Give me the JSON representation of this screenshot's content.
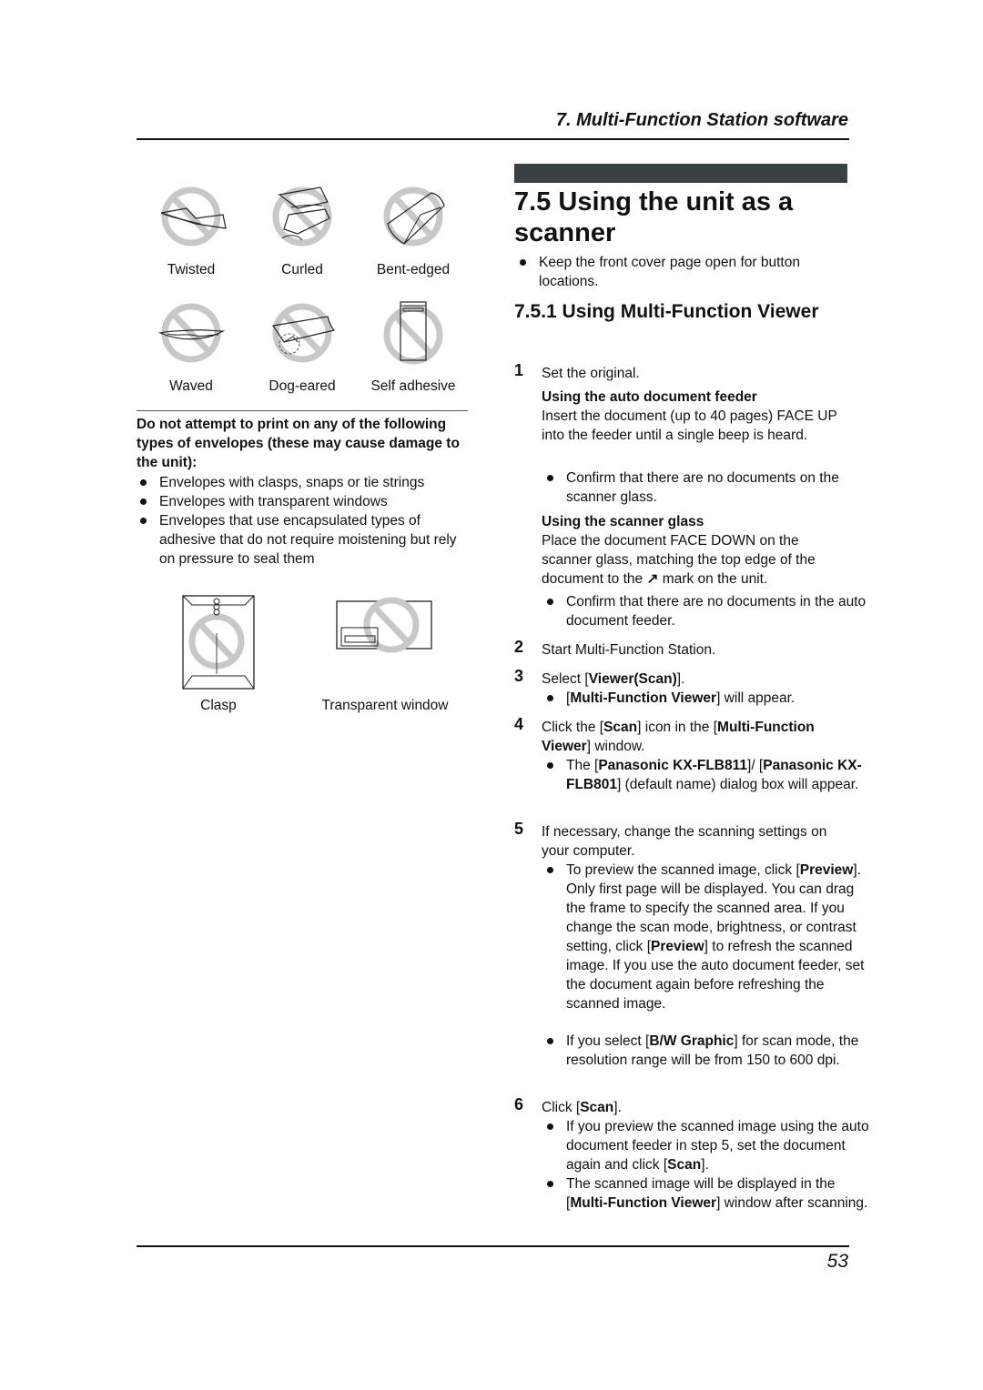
{
  "header": {
    "chapter_title": "7. Multi-Function Station software"
  },
  "footer": {
    "page_number": "53"
  },
  "left": {
    "paper_icons": [
      {
        "label": "Twisted",
        "icon": "twisted-paper-prohibited-icon"
      },
      {
        "label": "Curled",
        "icon": "curled-paper-prohibited-icon"
      },
      {
        "label": "Bent-edged",
        "icon": "bent-edged-paper-prohibited-icon"
      },
      {
        "label": "Waved",
        "icon": "waved-paper-prohibited-icon"
      },
      {
        "label": "Dog-eared",
        "icon": "dog-eared-paper-prohibited-icon"
      },
      {
        "label": "Self adhesive",
        "icon": "self-adhesive-envelope-prohibited-icon"
      }
    ],
    "warning_heading": "Do not attempt to print on any of the following types of envelopes (these may cause damage to the unit):",
    "warning_bullets": [
      "Envelopes with clasps, snaps or tie strings",
      "Envelopes with transparent windows",
      "Envelopes that use encapsulated types of adhesive that do not require moistening but rely on pressure to seal them"
    ],
    "envelope_icons": [
      {
        "label": "Clasp",
        "icon": "clasp-envelope-prohibited-icon"
      },
      {
        "label": "Transparent window",
        "icon": "window-envelope-prohibited-icon"
      }
    ]
  },
  "right": {
    "section_title": "7.5 Using the unit as a scanner",
    "section_note": "Keep the front cover page open for button locations.",
    "subsection_title": "7.5.1 Using Multi-Function Viewer",
    "steps": {
      "s1": {
        "num": "1",
        "text": "Set the original."
      },
      "adf_heading": "Using the auto document feeder",
      "adf_text": "Insert the document (up to 40 pages) FACE UP into the feeder until a single beep is heard.",
      "adf_bullet": "Confirm that there are no documents on the scanner glass.",
      "glass_heading": "Using the scanner glass",
      "glass_text_a": "Place the document FACE DOWN on the scanner glass, matching the top edge of the document to the",
      "glass_mark": "arrow-mark-icon",
      "glass_text_b": "mark on the unit.",
      "glass_bullet": "Confirm that there are no documents in the auto document feeder.",
      "s2": {
        "num": "2",
        "text": "Start Multi-Function Station."
      },
      "s3": {
        "num": "3",
        "text_a": "Select ",
        "bold": "Viewer(Scan)",
        "text_b": ".",
        "bullet_bold": "Multi-Function Viewer",
        "bullet_text": " will appear."
      },
      "s4": {
        "num": "4",
        "text_a": "Click the ",
        "bold1": "Scan",
        "text_b": " icon in the ",
        "bold2": "Multi-Function Viewer",
        "text_c": " window.",
        "bullet_a": "The ",
        "bullet_bold1": "Panasonic KX-FLB811",
        "bullet_sep": "/",
        "bullet_bold2": "Panasonic KX-FLB801",
        "bullet_b": " (default name) dialog box will appear."
      },
      "s5": {
        "num": "5",
        "text": "If necessary, change the scanning settings on your computer.",
        "b1_a": "To preview the scanned image, click ",
        "b1_bold1": "Preview",
        "b1_b": ". Only first page will be displayed. You can drag the frame to specify the scanned area. If you change the scan mode, brightness, or contrast setting, click ",
        "b1_bold2": "Preview",
        "b1_c": " to refresh the scanned image. If you use the auto document feeder, set the document again before refreshing the scanned image.",
        "b2_a": "If you select ",
        "b2_bold": "B/W Graphic",
        "b2_b": " for scan mode, the resolution range will be from 150 to 600 dpi."
      },
      "s6": {
        "num": "6",
        "text_a": "Click ",
        "bold": "Scan",
        "text_b": ".",
        "b1_a": "If you preview the scanned image using the auto document feeder in step 5, set the document again and click ",
        "b1_bold": "Scan",
        "b1_b": ".",
        "b2_a": "The scanned image will be displayed in the ",
        "b2_bold": "Multi-Function Viewer",
        "b2_b": " window after scanning."
      }
    }
  }
}
